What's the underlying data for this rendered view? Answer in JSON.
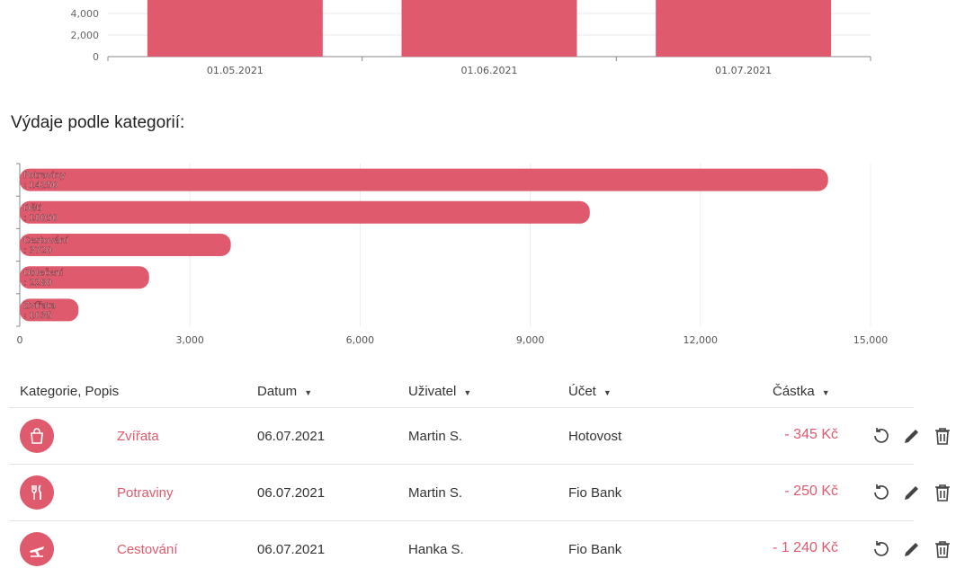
{
  "monthly_chart": {
    "chart_data": {
      "type": "bar",
      "categories": [
        "01.05.2021",
        "01.06.2021",
        "01.07.2021"
      ],
      "y_ticks": [
        "0",
        "2,000",
        "4,000"
      ],
      "bar_color": "#e05a6d"
    }
  },
  "section_title": "Výdaje podle kategorií:",
  "category_chart": {
    "chart_data": {
      "type": "bar",
      "orientation": "horizontal",
      "categories": [
        "Potraviny",
        "Děti",
        "Cestování",
        "Oblečení",
        "Zvířata"
      ],
      "values": [
        14250,
        10050,
        3720,
        2280,
        1035
      ],
      "value_labels": [
        ": 14250",
        ": 10050",
        ": 3720",
        ": 2280",
        ": 1035"
      ],
      "xlim": [
        0,
        15000
      ],
      "x_ticks": [
        "0",
        "3,000",
        "6,000",
        "9,000",
        "12,000",
        "15,000"
      ],
      "grid": true,
      "bar_color": "#e05a6d"
    }
  },
  "table": {
    "headers": {
      "category": "Kategorie, Popis",
      "date": "Datum",
      "user": "Uživatel",
      "account": "Účet",
      "amount": "Částka"
    },
    "rows": [
      {
        "icon": "shopping-bag-icon",
        "category": "Zvířata",
        "date": "06.07.2021",
        "user": "Martin S.",
        "account": "Hotovost",
        "amount": "- 345 Kč"
      },
      {
        "icon": "fork-knife-icon",
        "category": "Potraviny",
        "date": "06.07.2021",
        "user": "Martin S.",
        "account": "Fio Bank",
        "amount": "- 250 Kč"
      },
      {
        "icon": "airplane-icon",
        "category": "Cestování",
        "date": "06.07.2021",
        "user": "Hanka S.",
        "account": "Fio Bank",
        "amount": "- 1 240 Kč"
      }
    ]
  },
  "accent_color": "#e05a6d"
}
